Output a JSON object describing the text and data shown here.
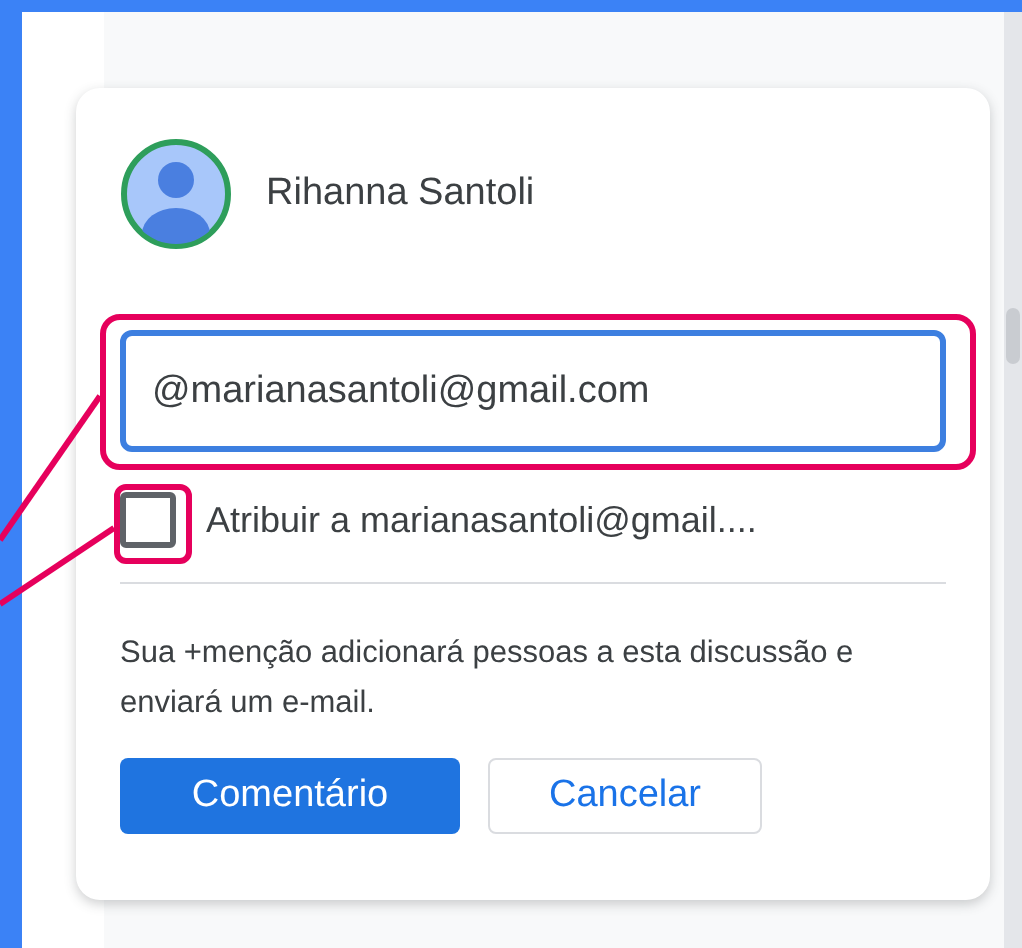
{
  "comment_box": {
    "author": "Rihanna Santoli",
    "input": {
      "value": "@marianasantoli@gmail.com"
    },
    "assign": {
      "label": "Atribuir a marianasantoli@gmail....",
      "checked": false
    },
    "notice": "Sua +menção adicionará pessoas a esta discussão e enviará um e-mail.",
    "buttons": [
      {
        "label": "Comentário",
        "kind": "primary"
      },
      {
        "label": "Cancelar",
        "kind": "secondary"
      }
    ]
  }
}
